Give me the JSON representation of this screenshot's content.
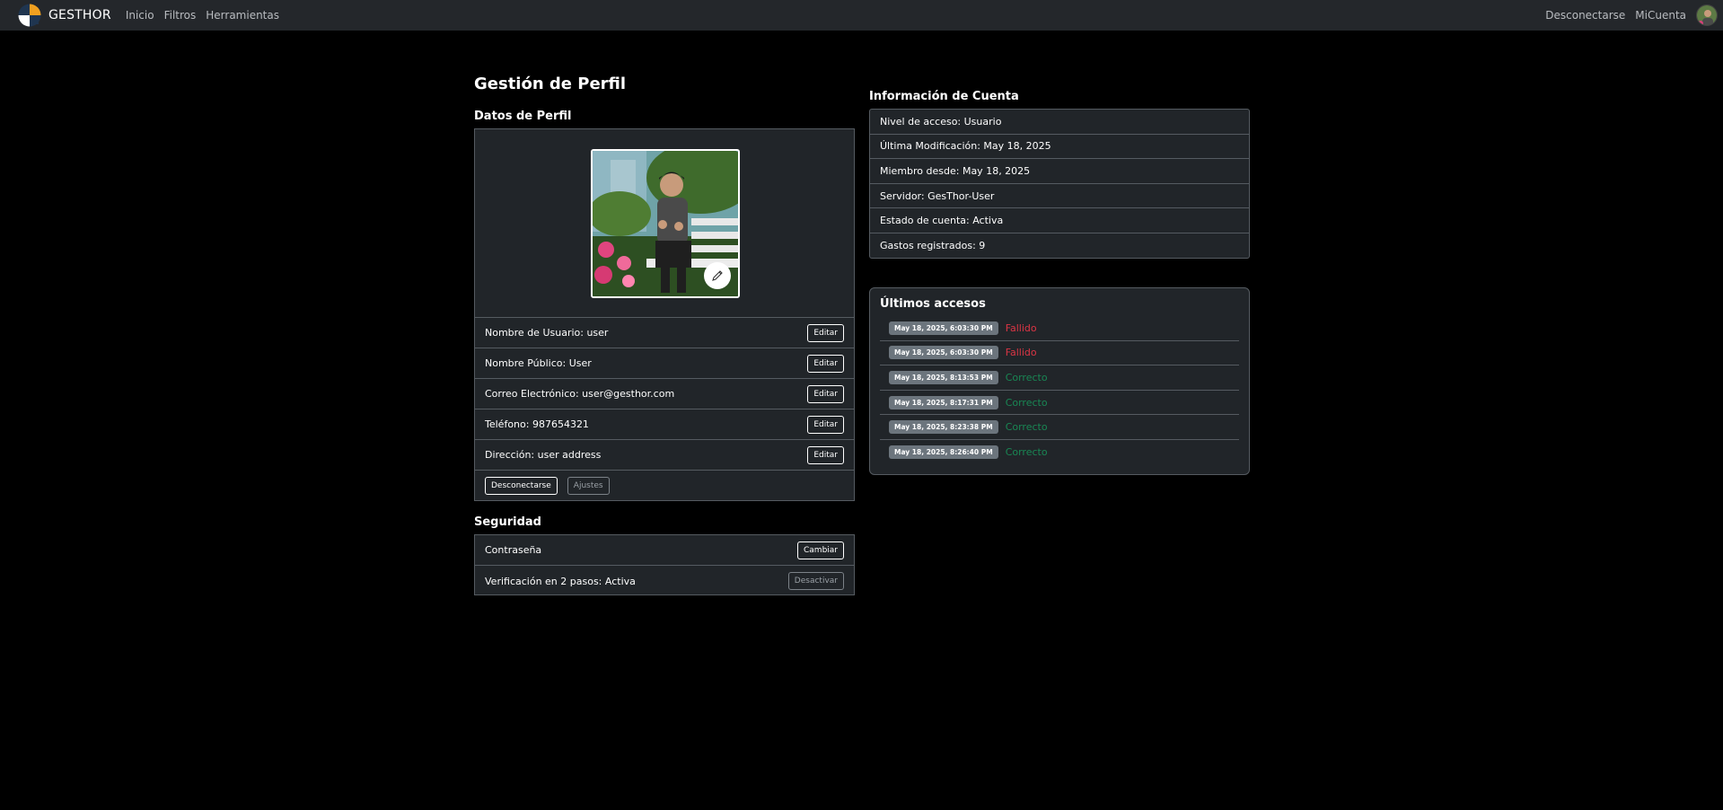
{
  "navbar": {
    "brand": "GESTHOR",
    "links": [
      "Inicio",
      "Filtros",
      "Herramientas"
    ],
    "logout": "Desconectarse",
    "account": "MiCuenta"
  },
  "page_title": "Gestión de Perfil",
  "profile": {
    "section_title": "Datos de Perfil",
    "fields": [
      {
        "label": "Nombre de Usuario: user",
        "button": "Editar"
      },
      {
        "label": "Nombre Público: User",
        "button": "Editar"
      },
      {
        "label": "Correo Electrónico: user@gesthor.com",
        "button": "Editar"
      },
      {
        "label": "Teléfono: 987654321",
        "button": "Editar"
      },
      {
        "label": "Dirección: user address",
        "button": "Editar"
      }
    ],
    "logout_button": "Desconectarse",
    "settings_button": "Ajustes"
  },
  "security": {
    "section_title": "Seguridad",
    "password_label": "Contraseña",
    "password_button": "Cambiar",
    "twofa_label": "Verificación en 2 pasos: Activa",
    "twofa_button": "Desactivar"
  },
  "account_info": {
    "section_title": "Información de Cuenta",
    "rows": [
      "Nivel de acceso: Usuario",
      "Última Modificación: May 18, 2025",
      "Miembro desde: May 18, 2025",
      "Servidor: GesThor-User",
      "Estado de cuenta: Activa",
      "Gastos registrados: 9"
    ]
  },
  "accesses": {
    "title": "Últimos accesos",
    "items": [
      {
        "time": "May 18, 2025, 6:03:30 PM",
        "status": "Fallido",
        "color": "#dc3545"
      },
      {
        "time": "May 18, 2025, 6:03:30 PM",
        "status": "Fallido",
        "color": "#dc3545"
      },
      {
        "time": "May 18, 2025, 8:13:53 PM",
        "status": "Correcto",
        "color": "#198754"
      },
      {
        "time": "May 18, 2025, 8:17:31 PM",
        "status": "Correcto",
        "color": "#198754"
      },
      {
        "time": "May 18, 2025, 8:23:38 PM",
        "status": "Correcto",
        "color": "#198754"
      },
      {
        "time": "May 18, 2025, 8:26:40 PM",
        "status": "Correcto",
        "color": "#198754"
      }
    ]
  },
  "icons": {
    "logo": "gesthor-logo-icon",
    "edit_photo": "pencil-icon",
    "avatar": "user-avatar"
  }
}
